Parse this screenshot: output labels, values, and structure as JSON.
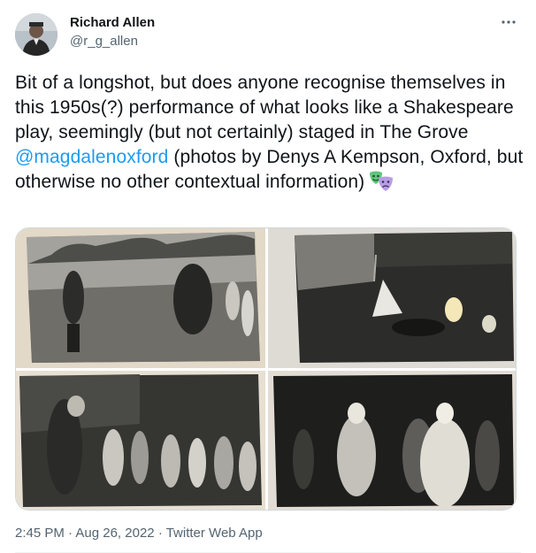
{
  "tweet": {
    "author_name": "Richard Allen",
    "author_handle": "@r_g_allen",
    "text_part1": "Bit of a longshot, but does anyone recognise themselves in this 1950s(?) performance of what looks like a Shakespeare play, seemingly (but not certainly) staged in The Grove ",
    "mention": "@magdalenoxford",
    "text_part2": " (photos by Denys A Kempson, Oxford, but otherwise no other contextual information)",
    "emoji": "performing-arts-masks",
    "media": [
      {
        "alt": "outdoor-performance-photo-1"
      },
      {
        "alt": "night-performance-photo-2"
      },
      {
        "alt": "courtroom-scene-photo-3"
      },
      {
        "alt": "king-and-queen-photo-4"
      }
    ],
    "time": "2:45 PM",
    "separator": "·",
    "date": "Aug 26, 2022",
    "source": "Twitter Web App"
  },
  "colors": {
    "accent": "#1d9bf0",
    "text": "#0f1419",
    "secondary": "#536471",
    "border": "#cfd9de"
  }
}
